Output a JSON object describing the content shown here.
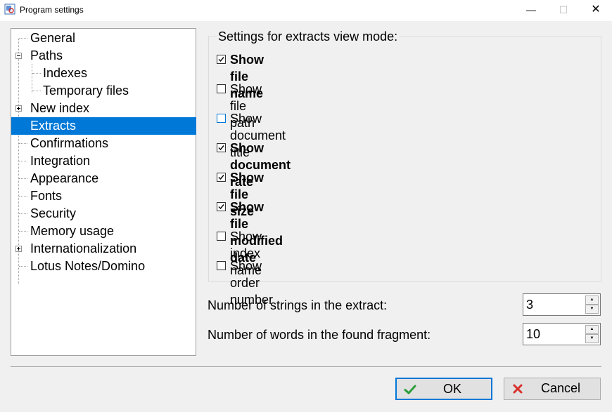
{
  "window": {
    "title": "Program settings",
    "minimize_glyph": "—",
    "maximize_glyph": "☐",
    "close_glyph": "✕"
  },
  "tree": {
    "items": [
      {
        "label": "General",
        "level": 0
      },
      {
        "label": "Paths",
        "level": 0,
        "expander": "collapse"
      },
      {
        "label": "Indexes",
        "level": 1
      },
      {
        "label": "Temporary files",
        "level": 1
      },
      {
        "label": "New index",
        "level": 0,
        "expander": "expand"
      },
      {
        "label": "Extracts",
        "level": 0,
        "selected": true
      },
      {
        "label": "Confirmations",
        "level": 0
      },
      {
        "label": "Integration",
        "level": 0
      },
      {
        "label": "Appearance",
        "level": 0
      },
      {
        "label": "Fonts",
        "level": 0
      },
      {
        "label": "Security",
        "level": 0
      },
      {
        "label": "Memory usage",
        "level": 0
      },
      {
        "label": "Internationalization",
        "level": 0,
        "expander": "expand"
      },
      {
        "label": "Lotus Notes/Domino",
        "level": 0
      }
    ]
  },
  "extracts": {
    "group_caption": "Settings for extracts view mode:",
    "options": [
      {
        "label": "Show file name",
        "checked": true
      },
      {
        "label": "Show file path",
        "checked": false
      },
      {
        "label": "Show document title",
        "checked": false,
        "focused": true
      },
      {
        "label": "Show document rate",
        "checked": true
      },
      {
        "label": "Show file size",
        "checked": true
      },
      {
        "label": "Show file modified date",
        "checked": true
      },
      {
        "label": "Show index name",
        "checked": false
      },
      {
        "label": "Show order number",
        "checked": false
      }
    ],
    "strings_label": "Number of strings in the extract:",
    "strings_value": "3",
    "words_label": "Number of words in the found fragment:",
    "words_value": "10"
  },
  "buttons": {
    "ok_label": "OK",
    "cancel_label": "Cancel"
  },
  "colors": {
    "accent": "#0078d7",
    "ok_check": "#2e9e3a",
    "cancel_x": "#d9302c"
  },
  "icons": [
    "app-icon",
    "check-icon",
    "x-icon",
    "spin-up-icon",
    "spin-down-icon"
  ]
}
